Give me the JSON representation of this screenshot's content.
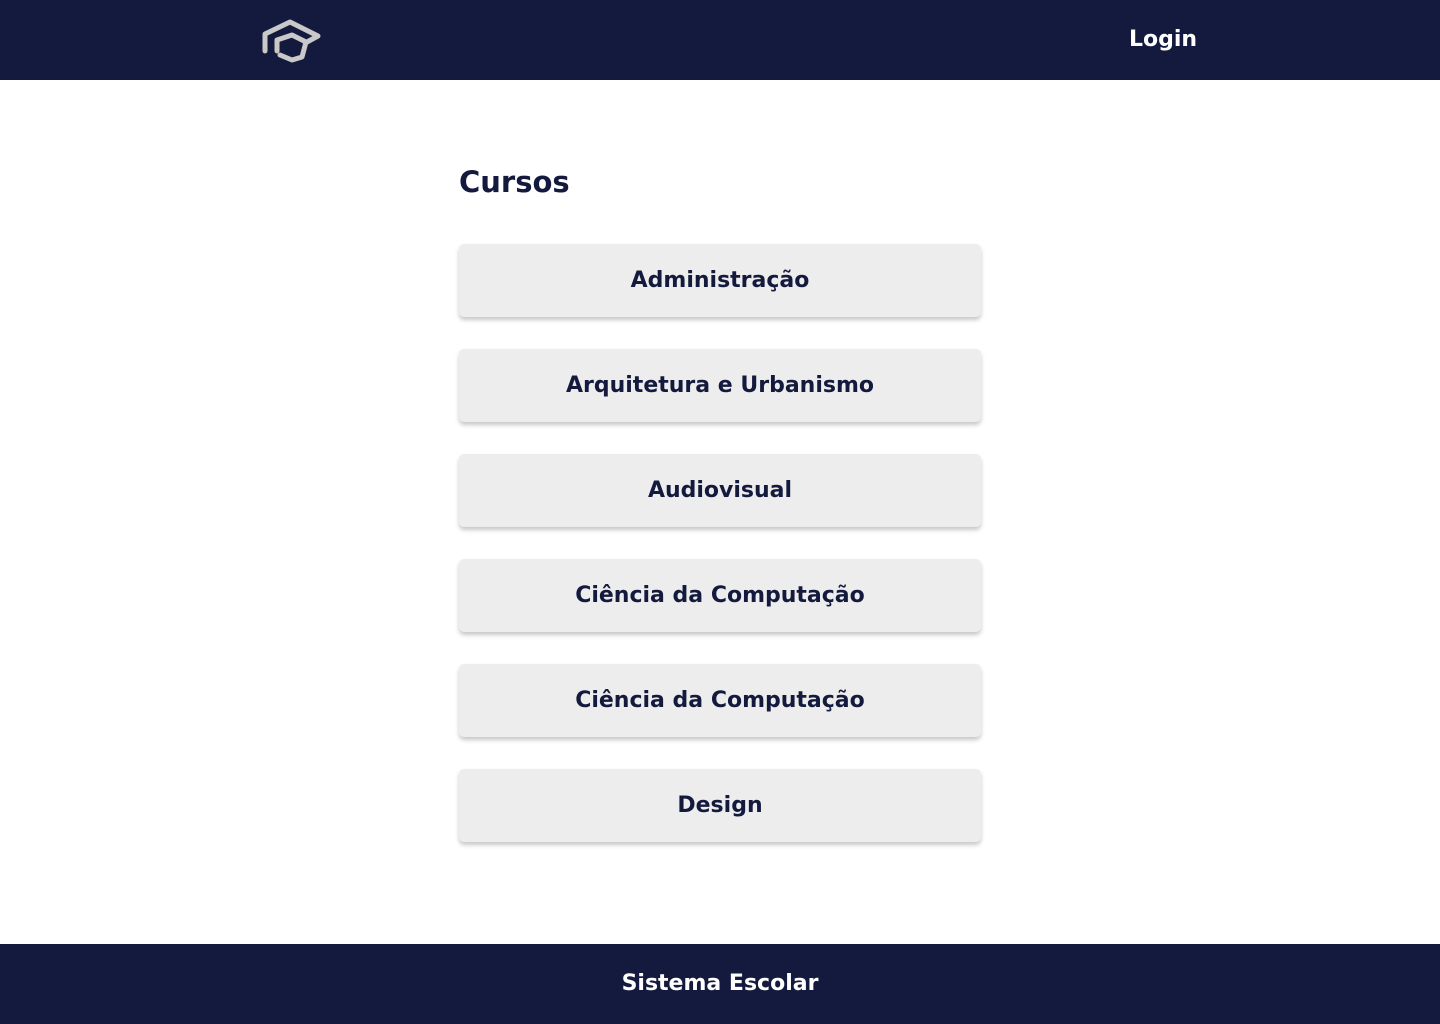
{
  "header": {
    "logo_icon": "graduation-cap-icon",
    "login_label": "Login"
  },
  "main": {
    "title": "Cursos",
    "courses": [
      {
        "label": "Administração"
      },
      {
        "label": "Arquitetura e Urbanismo"
      },
      {
        "label": "Audiovisual"
      },
      {
        "label": "Ciência da Computação"
      },
      {
        "label": "Ciência da Computação"
      },
      {
        "label": "Design"
      }
    ]
  },
  "footer": {
    "text": "Sistema Escolar"
  },
  "colors": {
    "primary": "#141a3d",
    "button_background": "#ededed",
    "logo": "#c9c9c9",
    "page_background": "#ffffff"
  }
}
